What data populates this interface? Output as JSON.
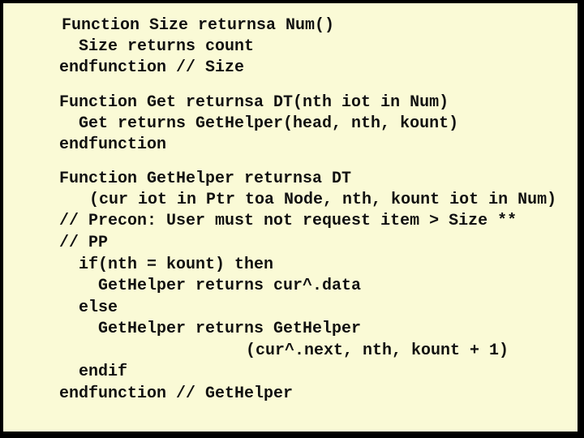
{
  "slide": {
    "background_color": "#FAFAD6",
    "border_color": "#000000",
    "code_blocks": [
      {
        "name": "size-function",
        "lines": [
          {
            "indent": 0,
            "text": "Function Size returnsa Num()"
          },
          {
            "indent": 2,
            "text": "Size returns count"
          },
          {
            "indent": 0,
            "text": "endfunction // Size"
          }
        ]
      },
      {
        "name": "get-function",
        "lines": [
          {
            "indent": 0,
            "text": "Function Get returnsa DT(nth iot in Num)"
          },
          {
            "indent": 2,
            "text": "Get returns GetHelper(head, nth, kount)"
          },
          {
            "indent": 0,
            "text": "endfunction"
          }
        ]
      },
      {
        "name": "gethelper-function",
        "lines": [
          {
            "indent": 0,
            "text": "Function GetHelper returnsa DT"
          },
          {
            "indent": 3,
            "text": "(cur iot in Ptr toa Node, nth, kount iot in Num)"
          },
          {
            "indent": 0,
            "text": "// Precon: User must not request item > Size **"
          },
          {
            "indent": 0,
            "text": "// PP"
          },
          {
            "indent": 2,
            "text": "if(nth = kount) then"
          },
          {
            "indent": 4,
            "text": "GetHelper returns cur^.data"
          },
          {
            "indent": 2,
            "text": "else"
          },
          {
            "indent": 4,
            "text": "GetHelper returns GetHelper"
          },
          {
            "indent": 19,
            "text": "(cur^.next, nth, kount + 1)"
          },
          {
            "indent": 2,
            "text": "endif"
          },
          {
            "indent": 0,
            "text": "endfunction // GetHelper"
          }
        ]
      }
    ]
  }
}
